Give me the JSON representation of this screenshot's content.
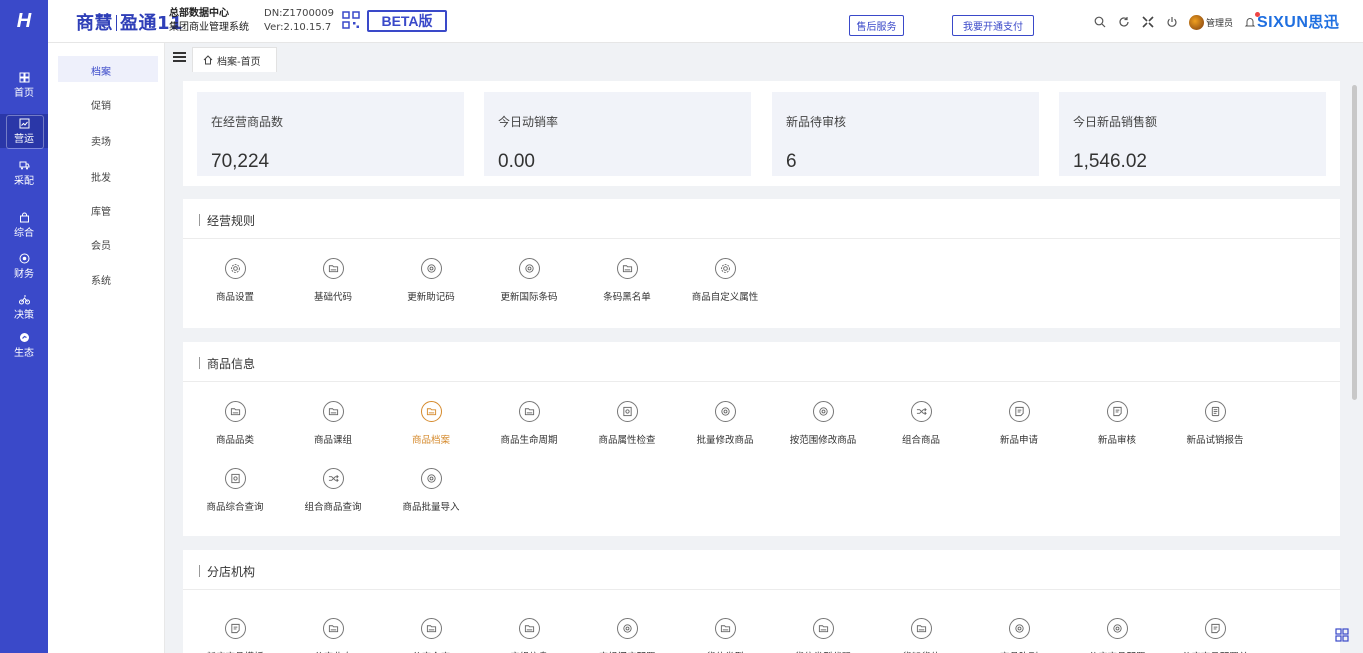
{
  "app": {
    "logo": "H",
    "brand_left": "商慧",
    "brand_right": "盈通11",
    "org_line1": "总部数据中心",
    "org_line2": "集团商业管理系统",
    "dn": "DN:Z1700009",
    "version": "Ver:2.10.15.7",
    "beta": "BETA版",
    "after_sales": "售后服务",
    "open_payment": "我要开通支付",
    "admin": "管理员",
    "vendor": "SIXUN",
    "vendor_cn": "思迅"
  },
  "nav": [
    {
      "label": "首页",
      "icon": "dashboard-icon"
    },
    {
      "label": "营运",
      "icon": "chart-icon",
      "active": true
    },
    {
      "label": "采配",
      "icon": "truck-icon"
    },
    {
      "label": "综合",
      "icon": "bag-icon"
    },
    {
      "label": "财务",
      "icon": "coin-icon"
    },
    {
      "label": "决策",
      "icon": "bike-icon"
    },
    {
      "label": "生态",
      "icon": "eco-icon"
    }
  ],
  "submenu": [
    "档案",
    "促销",
    "卖场",
    "批发",
    "库管",
    "会员",
    "系统"
  ],
  "tab": {
    "label": "档案-首页"
  },
  "stats": [
    {
      "label": "在经营商品数",
      "value": "70,224"
    },
    {
      "label": "今日动销率",
      "value": "0.00"
    },
    {
      "label": "新品待审核",
      "value": "6"
    },
    {
      "label": "今日新品销售额",
      "value": "1,546.02"
    }
  ],
  "sections": [
    {
      "title": "经营规则",
      "items": [
        {
          "label": "商品设置",
          "icon": "gear-icon"
        },
        {
          "label": "基础代码",
          "icon": "folder-icon"
        },
        {
          "label": "更新助记码",
          "icon": "target-icon"
        },
        {
          "label": "更新国际条码",
          "icon": "target-icon"
        },
        {
          "label": "条码黑名单",
          "icon": "folder-icon"
        },
        {
          "label": "商品自定义属性",
          "icon": "gear-icon"
        }
      ]
    },
    {
      "title": "商品信息",
      "items": [
        {
          "label": "商品品类",
          "icon": "folder-icon"
        },
        {
          "label": "商品课组",
          "icon": "folder-icon"
        },
        {
          "label": "商品档案",
          "icon": "folder-icon",
          "highlight": true
        },
        {
          "label": "商品生命周期",
          "icon": "folder-icon"
        },
        {
          "label": "商品属性检查",
          "icon": "doc-search-icon"
        },
        {
          "label": "批量修改商品",
          "icon": "target-icon"
        },
        {
          "label": "按范围修改商品",
          "icon": "target-icon"
        },
        {
          "label": "组合商品",
          "icon": "shuffle-icon"
        },
        {
          "label": "新品申请",
          "icon": "document-icon"
        },
        {
          "label": "新品审核",
          "icon": "document-icon"
        },
        {
          "label": "新品试销报告",
          "icon": "report-icon"
        },
        {
          "label": "商品综合查询",
          "icon": "doc-search-icon"
        },
        {
          "label": "组合商品查询",
          "icon": "shuffle-icon"
        },
        {
          "label": "商品批量导入",
          "icon": "target-icon"
        }
      ]
    },
    {
      "title": "分店机构",
      "items": [
        {
          "label": "新店商品模板",
          "icon": "document-icon"
        },
        {
          "label": "分店业态",
          "icon": "folder-icon"
        },
        {
          "label": "分店仓库",
          "icon": "folder-icon"
        },
        {
          "label": "店组信息",
          "icon": "folder-icon"
        },
        {
          "label": "店组门店配置",
          "icon": "target-icon"
        },
        {
          "label": "货位类型",
          "icon": "folder-icon"
        },
        {
          "label": "货位类型代码",
          "icon": "folder-icon"
        },
        {
          "label": "货架货位",
          "icon": "folder-icon"
        },
        {
          "label": "商品陈列",
          "icon": "target-icon"
        },
        {
          "label": "分店商品配置",
          "icon": "target-icon"
        },
        {
          "label": "分店商品配置单",
          "icon": "document-icon"
        }
      ]
    }
  ]
}
